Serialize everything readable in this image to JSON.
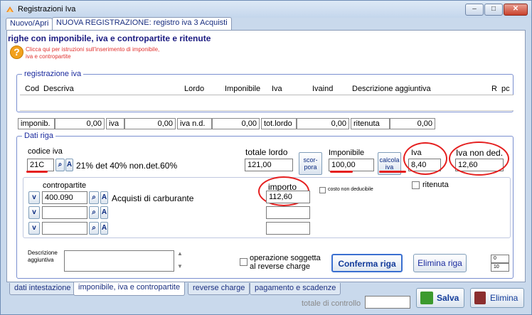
{
  "window": {
    "title": "Registrazioni Iva",
    "buttons": {
      "minimize": "–",
      "maximize": "□",
      "close": "✕"
    }
  },
  "top_tabs": [
    "Nuovo/Apri",
    "NUOVA REGISTRAZIONE: registro iva 3 Acquisti"
  ],
  "heading": "righe con imponibile, iva e contropartite e ritenute",
  "help_text": "Clicca qui per istruzioni sull'inserimento di imponibile, iva e contropartite",
  "registrazione": {
    "legend": "registrazione iva",
    "columns": [
      "Cod",
      "Descriva",
      "Lordo",
      "Imponibile",
      "Iva",
      "Ivaind",
      "Descrizione aggiuntiva",
      "R",
      "pc"
    ]
  },
  "totals": [
    {
      "label": "imponib.",
      "value": "0,00"
    },
    {
      "label": "iva",
      "value": "0,00"
    },
    {
      "label": "iva n.d.",
      "value": "0,00"
    },
    {
      "label": "tot.lordo",
      "value": "0,00"
    },
    {
      "label": "ritenuta",
      "value": "0,00"
    }
  ],
  "dati_riga": {
    "legend": "Dati riga",
    "codice_iva_label": "codice iva",
    "codice_iva_value": "21C",
    "codice_iva_desc": "21% det 40% non.det.60%",
    "lordo_label": "totale lordo",
    "lordo_value": "121,00",
    "scorpora_label": "scor- pora",
    "imponibile_label": "Imponibile",
    "imponibile_value": "100,00",
    "calcola_iva_label": "calcola iva",
    "iva_label": "Iva",
    "iva_value": "8,40",
    "iva_nd_label": "Iva non ded.",
    "iva_nd_value": "12,60",
    "contropartite_label": "contropartite",
    "importo_label": "importo",
    "ritenuta_label": "ritenuta",
    "costo_nd_label": "costo non deducibile",
    "rows": [
      {
        "conto": "400.090",
        "desc": "Acquisti di carburante",
        "importo": "112,60"
      },
      {
        "conto": "",
        "desc": "",
        "importo": ""
      },
      {
        "conto": "",
        "desc": "",
        "importo": ""
      }
    ],
    "descrizione_label": "Descrizione aggiuntiva",
    "reverse_label": "operazione soggetta al reverse charge",
    "conferma": "Conferma riga",
    "elimina_riga": "Elimina riga",
    "counter_top": "0",
    "counter_bottom": "10"
  },
  "bottom_tabs": [
    "dati intestazione",
    "imponibile, iva e contropartite",
    "reverse charge",
    "pagamento e scadenze"
  ],
  "controllo_label": "totale di controllo",
  "salva": "Salva",
  "elimina": "Elimina",
  "colors": {
    "accent": "#1a1a80",
    "annotation": "#e52020",
    "help": "#e0322f"
  }
}
